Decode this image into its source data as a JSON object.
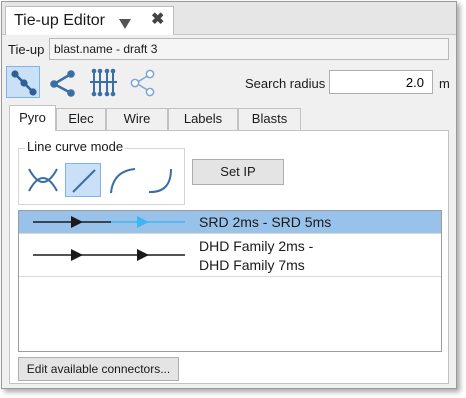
{
  "window": {
    "tab_title": "Tie-up Editor",
    "dropdown_icon": "triangle-down-icon",
    "close_icon": "close-icon"
  },
  "tieup": {
    "label": "Tie-up",
    "value": "blast.name - draft 3"
  },
  "toolbar": {
    "tools": [
      {
        "icon": "connect-line-icon",
        "active": true
      },
      {
        "icon": "branch-connect-icon",
        "active": false
      },
      {
        "icon": "bus-connect-icon",
        "active": false
      },
      {
        "icon": "share-outline-icon",
        "active": false
      }
    ]
  },
  "search_radius": {
    "label": "Search radius",
    "value": "2.0",
    "unit": "m"
  },
  "tabs": [
    "Pyro",
    "Elec",
    "Wire",
    "Labels",
    "Blasts"
  ],
  "active_tab": "Pyro",
  "line_curve_mode": {
    "title": "Line curve mode",
    "modes": [
      {
        "icon": "cross-curve-icon",
        "active": false
      },
      {
        "icon": "straight-line-icon",
        "active": true
      },
      {
        "icon": "arc-curve-icon",
        "active": false
      },
      {
        "icon": "s-curve-icon",
        "active": false
      }
    ]
  },
  "set_ip_label": "Set IP",
  "connectors": [
    {
      "label": "SRD 2ms - SRD 5ms",
      "selected": true
    },
    {
      "label": "DHD Family 2ms -\nDHD Family 7ms",
      "selected": false
    }
  ],
  "edit_button_label": "Edit available connectors...",
  "colors": {
    "accent": "#3a6ea5",
    "selection": "#99c2ea",
    "arrow_light": "#3fb6f0",
    "icon_blue": "#3a6ea5"
  }
}
